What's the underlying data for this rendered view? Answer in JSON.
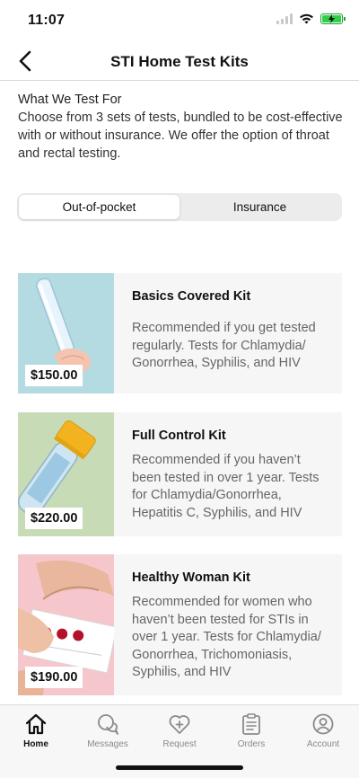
{
  "status": {
    "time": "11:07"
  },
  "nav": {
    "title": "STI Home Test Kits"
  },
  "intro": {
    "heading": "What We Test For",
    "body": "Choose from 3 sets of tests, bundled to be cost-effective with or without insurance. We offer the option of throat and rectal testing."
  },
  "segments": {
    "selected": "Out-of-pocket",
    "items": [
      "Out-of-pocket",
      "Insurance"
    ]
  },
  "kits": [
    {
      "name": "Basics Covered Kit",
      "price": "$150.00",
      "description": "Recommended if you get tested regularly. Tests for Chlamydia/ Gonorrhea, Syphilis, and HIV",
      "image_bg": "#b5dbe2"
    },
    {
      "name": "Full Control Kit",
      "price": "$220.00",
      "description": "Recommended if you haven’t been tested in over 1 year. Tests for Chlamydia/Gonorrhea, Hepatitis C, Syphilis, and HIV",
      "image_bg": "#c7dbb6"
    },
    {
      "name": "Healthy Woman Kit",
      "price": "$190.00",
      "description": "Recommended for women who haven’t been tested for STIs in over 1 year. Tests for Chlamydia/ Gonorrhea, Trichomoniasis, Syphilis, and HIV",
      "image_bg": "#f6c6cd"
    }
  ],
  "tabs": [
    {
      "label": "Home",
      "icon": "home-icon",
      "active": true
    },
    {
      "label": "Messages",
      "icon": "messages-icon",
      "active": false
    },
    {
      "label": "Request",
      "icon": "heart-plus-icon",
      "active": false
    },
    {
      "label": "Orders",
      "icon": "clipboard-icon",
      "active": false
    },
    {
      "label": "Account",
      "icon": "account-icon",
      "active": false
    }
  ],
  "colors": {
    "battery": "#2fcf4a",
    "card_bg": "#f6f6f6",
    "inactive_tab": "#8a8a8a"
  }
}
